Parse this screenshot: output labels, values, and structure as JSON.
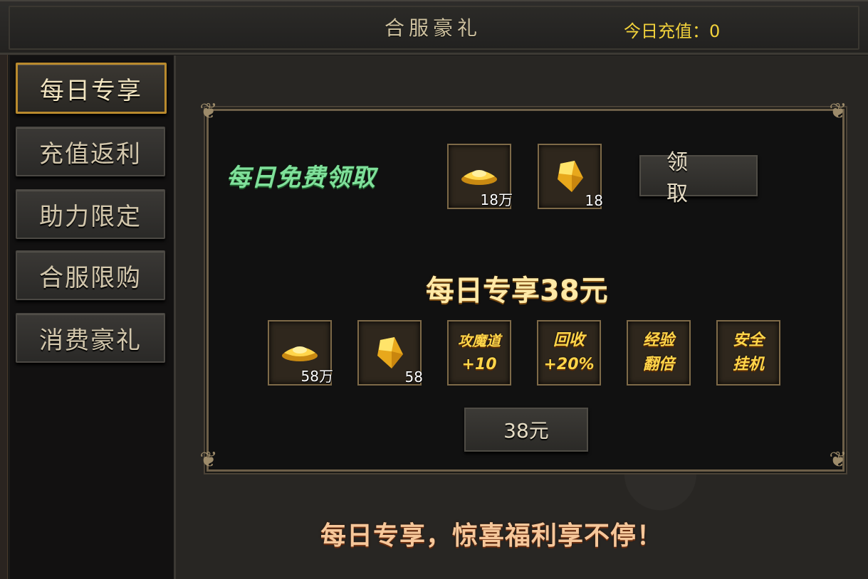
{
  "header": {
    "title": "合服豪礼",
    "recharge_label": "今日充值：0"
  },
  "sidebar": {
    "items": [
      {
        "label": "每日专享",
        "active": true
      },
      {
        "label": "充值返利",
        "active": false
      },
      {
        "label": "助力限定",
        "active": false
      },
      {
        "label": "合服限购",
        "active": false
      },
      {
        "label": "消费豪礼",
        "active": false
      }
    ]
  },
  "free_section": {
    "label": "每日免费领取",
    "rewards": [
      {
        "icon": "gold-ingot-icon",
        "qty": "18万"
      },
      {
        "icon": "yellow-gem-icon",
        "qty": "18"
      }
    ],
    "claim_label": "领 取"
  },
  "paid_section": {
    "heading": "每日专享38元",
    "rewards": [
      {
        "icon": "gold-ingot-icon",
        "qty": "58万"
      },
      {
        "icon": "yellow-gem-icon",
        "qty": "58"
      }
    ],
    "perks": [
      {
        "line1": "攻魔道",
        "line2": "+10"
      },
      {
        "line1": "回收",
        "line2": "+20%"
      },
      {
        "line1": "经验",
        "line2": "翻倍"
      },
      {
        "line1": "安全",
        "line2": "挂机"
      }
    ],
    "price_label": "38元"
  },
  "slogan": "每日专享，惊喜福利享不停！",
  "colors": {
    "accent_gold": "#f2d23b",
    "active_border": "#b98a2d",
    "free_label_green": "#7fe09a"
  }
}
